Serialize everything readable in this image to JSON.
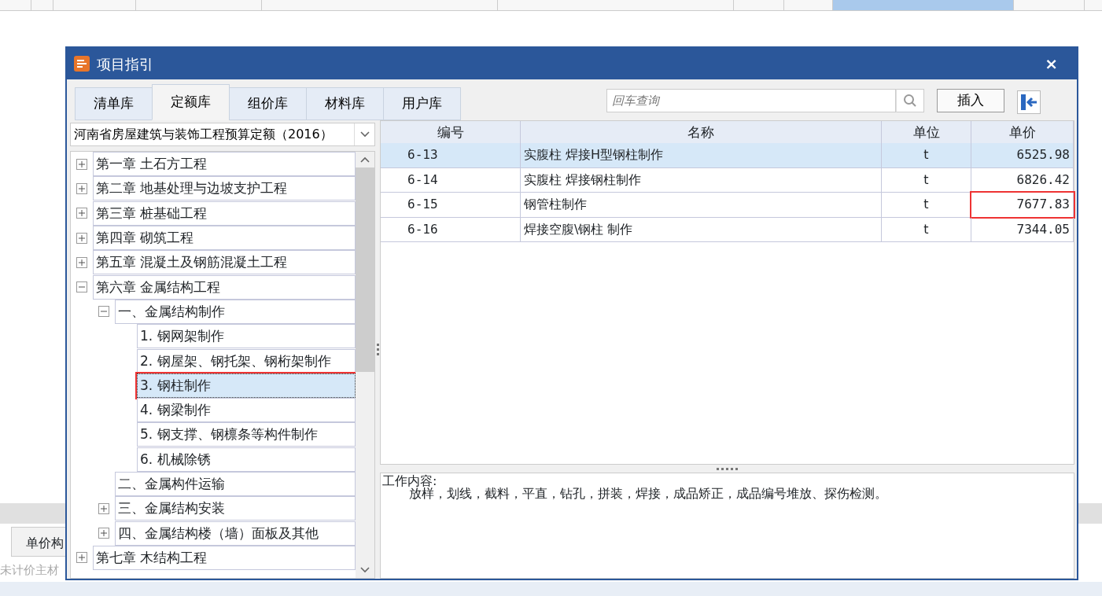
{
  "background": {
    "tab": "单价构",
    "label": "未计价主材"
  },
  "dialog": {
    "title": "项目指引",
    "close": "×"
  },
  "tabs": [
    {
      "label": "清单库",
      "selected": false
    },
    {
      "label": "定额库",
      "selected": true
    },
    {
      "label": "组价库",
      "selected": false
    },
    {
      "label": "材料库",
      "selected": false
    },
    {
      "label": "用户库",
      "selected": false
    }
  ],
  "search": {
    "placeholder": "回车查询"
  },
  "insert_button": "插入",
  "library": {
    "value": "河南省房屋建筑与装饰工程预算定额（2016）"
  },
  "tree": [
    {
      "label": "第一章 土石方工程",
      "expanded": false,
      "selected": false,
      "marked": false
    },
    {
      "label": "第二章 地基处理与边坡支护工程",
      "expanded": false,
      "selected": false,
      "marked": false
    },
    {
      "label": "第三章 桩基础工程",
      "expanded": false,
      "selected": false,
      "marked": false
    },
    {
      "label": "第四章 砌筑工程",
      "expanded": false,
      "selected": false,
      "marked": false
    },
    {
      "label": "第五章 混凝土及钢筋混凝土工程",
      "expanded": false,
      "selected": false,
      "marked": false
    },
    {
      "label": "第六章 金属结构工程",
      "expanded": true,
      "selected": false,
      "marked": false,
      "children": [
        {
          "label": "一、金属结构制作",
          "expanded": true,
          "selected": false,
          "marked": false,
          "children": [
            {
              "label": "1. 钢网架制作",
              "selected": false,
              "marked": false
            },
            {
              "label": "2. 钢屋架、钢托架、钢桁架制作",
              "selected": false,
              "marked": false
            },
            {
              "label": "3. 钢柱制作",
              "selected": true,
              "marked": true
            },
            {
              "label": "4. 钢梁制作",
              "selected": false,
              "marked": false
            },
            {
              "label": "5. 钢支撑、钢檩条等构件制作",
              "selected": false,
              "marked": false
            },
            {
              "label": "6. 机械除锈",
              "selected": false,
              "marked": false
            }
          ]
        },
        {
          "label": "二、金属构件运输",
          "selected": false,
          "marked": false
        },
        {
          "label": "三、金属结构安装",
          "expanded": false,
          "selected": false,
          "marked": false
        },
        {
          "label": "四、金属结构楼（墙）面板及其他",
          "expanded": false,
          "selected": false,
          "marked": false
        }
      ]
    },
    {
      "label": "第七章 木结构工程",
      "expanded": false,
      "selected": false,
      "marked": false
    }
  ],
  "table": {
    "columns": [
      "编号",
      "名称",
      "单位",
      "单价"
    ],
    "rows": [
      {
        "code": "6-13",
        "name": "实腹柱 焊接H型钢柱制作",
        "unit": "t",
        "price": "6525.98",
        "selected": true,
        "price_marked": false
      },
      {
        "code": "6-14",
        "name": "实腹柱 焊接钢柱制作",
        "unit": "t",
        "price": "6826.42",
        "selected": false,
        "price_marked": false
      },
      {
        "code": "6-15",
        "name": "钢管柱制作",
        "unit": "t",
        "price": "7677.83",
        "selected": false,
        "price_marked": true
      },
      {
        "code": "6-16",
        "name": "焊接空腹\\钢柱 制作",
        "unit": "t",
        "price": "7344.05",
        "selected": false,
        "price_marked": false
      }
    ]
  },
  "work_content": {
    "label": "工作内容:",
    "text": "放样，划线，截料，平直，钻孔，拼装，焊接，成品矫正，成品编号堆放、探伤检测。"
  }
}
